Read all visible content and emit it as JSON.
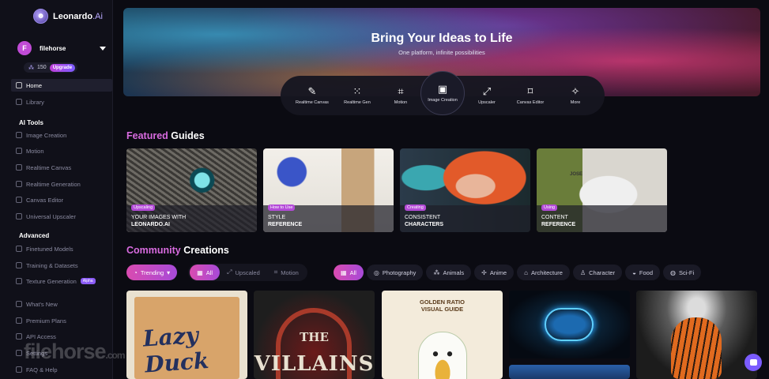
{
  "app": {
    "name": "Leonardo",
    "name_suffix": ".Ai"
  },
  "user": {
    "initial": "F",
    "name": "filehorse",
    "tokens": "150",
    "upgrade_label": "Upgrade"
  },
  "sidebar": {
    "top_items": [
      {
        "label": "Home",
        "icon": "home-icon"
      },
      {
        "label": "Library",
        "icon": "grid-icon"
      }
    ],
    "ai_tools_heading": "AI Tools",
    "ai_tools": [
      {
        "label": "Image Creation",
        "icon": "image-icon"
      },
      {
        "label": "Motion",
        "icon": "film-icon"
      },
      {
        "label": "Realtime Canvas",
        "icon": "brush-icon"
      },
      {
        "label": "Realtime Generation",
        "icon": "grid-dots-icon"
      },
      {
        "label": "Canvas Editor",
        "icon": "frame-icon"
      },
      {
        "label": "Universal Upscaler",
        "icon": "upscale-icon"
      }
    ],
    "advanced_heading": "Advanced",
    "advanced": [
      {
        "label": "Finetuned Models",
        "icon": "model-icon"
      },
      {
        "label": "Training & Datasets",
        "icon": "dataset-icon"
      },
      {
        "label": "Texture Generation",
        "icon": "texture-icon",
        "badge": "Alpha"
      }
    ],
    "bottom": [
      {
        "label": "What's New",
        "icon": "megaphone-icon"
      },
      {
        "label": "Premium Plans",
        "icon": "crown-icon"
      },
      {
        "label": "API Access",
        "icon": "key-icon"
      },
      {
        "label": "Settings",
        "icon": "gear-icon"
      },
      {
        "label": "FAQ & Help",
        "icon": "help-icon"
      }
    ],
    "watermark": "filehorse",
    "watermark_suffix": ".com"
  },
  "hero": {
    "title": "Bring Your Ideas to Life",
    "subtitle": "One platform, infinite possibilities"
  },
  "tools": [
    {
      "label": "Realtime Canvas",
      "glyph": "✎"
    },
    {
      "label": "Realtime Gen",
      "glyph": "⁙"
    },
    {
      "label": "Motion",
      "glyph": "⌗"
    },
    {
      "label": "Image Creation",
      "glyph": "▣"
    },
    {
      "label": "Upscaler",
      "glyph": "⤢"
    },
    {
      "label": "Canvas Editor",
      "glyph": "⌑"
    },
    {
      "label": "More",
      "glyph": "✧"
    }
  ],
  "featured": {
    "title_accent": "Featured",
    "title_rest": "Guides",
    "guides": [
      {
        "badge": "Upscaling",
        "line1": "YOUR IMAGES WITH",
        "line2": "LEONARDO.AI"
      },
      {
        "badge": "How to Use",
        "line1": "STYLE",
        "line2": "REFERENCE"
      },
      {
        "badge": "Creating",
        "line1": "CONSISTENT",
        "line2": "CHARACTERS"
      },
      {
        "badge": "Using",
        "line1": "CONTENT",
        "line2": "REFERENCE"
      }
    ]
  },
  "community": {
    "title_accent": "Community",
    "title_rest": "Creations",
    "sort": {
      "label": "Trending"
    },
    "type_filters": [
      "All",
      "Upscaled",
      "Motion"
    ],
    "category_filters": [
      "All",
      "Photography",
      "Animals",
      "Anime",
      "Architecture",
      "Character",
      "Food",
      "Sci-Fi"
    ],
    "card_texts": {
      "lazy_duck": "Lazy Duck",
      "the": "THE",
      "villains": "VILLAINS",
      "golden_ratio": "GOLDEN RATIO",
      "visual_guide": "VISUAL GUIDE"
    }
  },
  "guide_art_texts": {
    "shoe": "JOSE"
  },
  "colors": {
    "accent_pink": "#d86bdf",
    "accent_purple": "#7b5cff",
    "sidebar_bg": "#101019",
    "page_bg": "#0b0b12"
  }
}
